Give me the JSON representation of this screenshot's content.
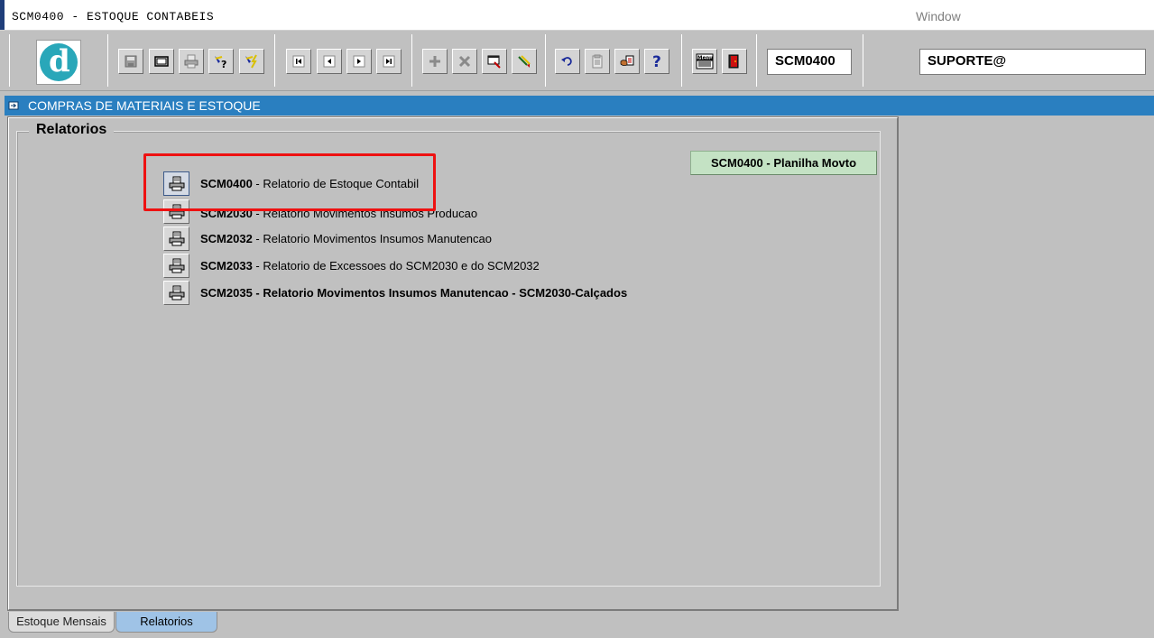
{
  "window": {
    "title": "SCM0400 - ESTOQUE CONTABEIS",
    "menu_window": "Window"
  },
  "toolbar": {
    "logo_letter": "d",
    "logo_color": "#29a7b9",
    "buttons": [
      "save-icon",
      "window-icon",
      "print-icon",
      "query-icon",
      "execute-query-icon",
      "first-record-icon",
      "previous-record-icon",
      "next-record-icon",
      "last-record-icon",
      "insert-record-icon",
      "delete-record-icon",
      "duplicate-icon",
      "edit-icon",
      "undo-icon",
      "clipboard-icon",
      "list-values-icon",
      "help-icon",
      "menu-icon",
      "exit-icon"
    ],
    "form_code": "SCM0400",
    "user": "SUPORTE@"
  },
  "header": {
    "module_title": "COMPRAS DE MATERIAIS E ESTOQUE",
    "bar_color": "#2a7fc0"
  },
  "main": {
    "group_title": "Relatorios",
    "planilha_button": "SCM0400 - Planilha Movto",
    "reports": [
      {
        "code": "SCM0400",
        "desc": " - Relatorio de Estoque Contabil",
        "icon": "printer-icon"
      },
      {
        "code": "SCM2030",
        "desc": " - Relatorio Movimentos Insumos Producao",
        "icon": "printer-icon"
      },
      {
        "code": "SCM2032",
        "desc": " - Relatorio Movimentos Insumos Manutencao",
        "icon": "printer-icon"
      },
      {
        "code": "SCM2033",
        "desc": " - Relatorio de Excessoes do SCM2030 e do SCM2032",
        "icon": "printer-icon"
      },
      {
        "code": "SCM2035",
        "desc": " - Relatorio Movimentos Insumos Manutencao - SCM2030-Calçados",
        "icon": "printer-icon"
      }
    ],
    "highlight_color": "#ee1111"
  },
  "tabs": [
    {
      "label": "Estoque Mensais",
      "active": false
    },
    {
      "label": "Relatorios",
      "active": true
    }
  ]
}
